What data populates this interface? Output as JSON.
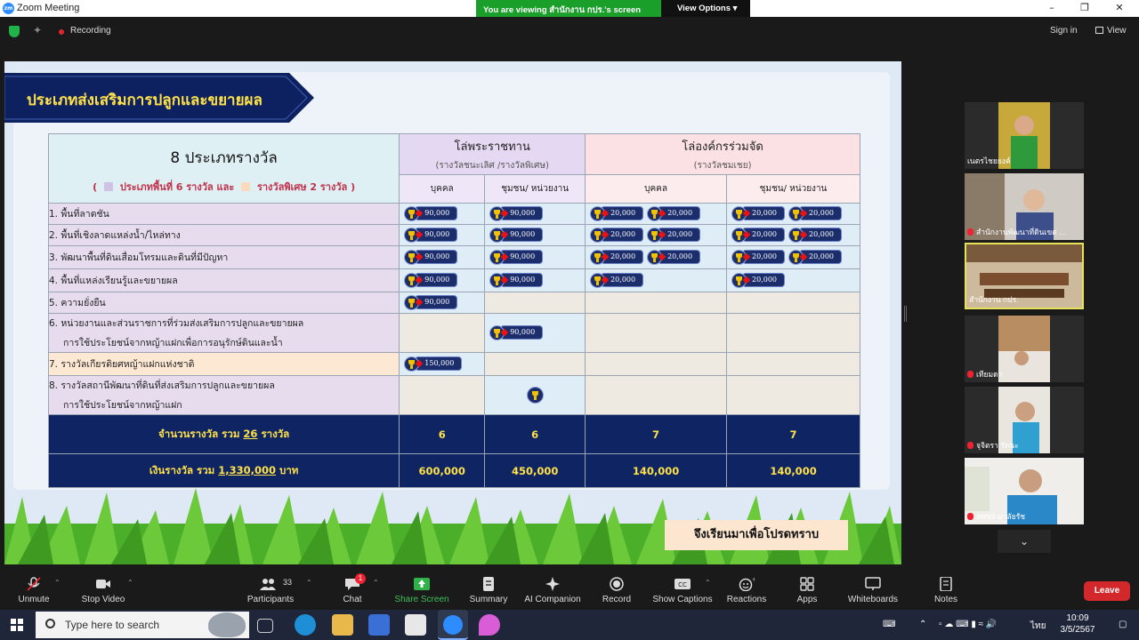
{
  "window": {
    "title": "Zoom Meeting",
    "viewing_message": "You are viewing สำนักงาน กปร.'s screen",
    "view_options": "View Options",
    "recording": "Recording",
    "sign_in": "Sign in",
    "view": "View"
  },
  "slide": {
    "banner_title": "ประเภทส่งเสริมการปลูกและขยายผล",
    "header": {
      "main_title": "8 ประเภทรางวัล",
      "legend_open": "(",
      "legend_area": "ประเภทพื้นที่ 6 รางวัล",
      "legend_and": "และ",
      "legend_special": "รางวัลพิเศษ 2 รางวัล )",
      "group1_title": "โล่พระราชทาน",
      "group1_sub": "(รางวัลชนะเลิศ /รางวัลพิเศษ)",
      "group2_title": "โล่องค์กรร่วมจัด",
      "group2_sub": "(รางวัลชมเชย)",
      "col_individual": "บุคคล",
      "col_community": "ชุมชน/ หน่วยงาน"
    },
    "rows": [
      {
        "label": "1. พื้นที่ลาดชัน",
        "c1": [
          "90,000"
        ],
        "c2": [
          "90,000"
        ],
        "c3": [
          "20,000",
          "20,000"
        ],
        "c4": [
          "20,000",
          "20,000"
        ]
      },
      {
        "label": "2. พื้นที่เชิงลาดแหล่งน้ำ/ไหล่ทาง",
        "c1": [
          "90,000"
        ],
        "c2": [
          "90,000"
        ],
        "c3": [
          "20,000",
          "20,000"
        ],
        "c4": [
          "20,000",
          "20,000"
        ]
      },
      {
        "label": "3. พัฒนาพื้นที่ดินเสื่อมโทรมและดินที่มีปัญหา",
        "c1": [
          "90,000"
        ],
        "c2": [
          "90,000"
        ],
        "c3": [
          "20,000",
          "20,000"
        ],
        "c4": [
          "20,000",
          "20,000"
        ]
      },
      {
        "label": "4. พื้นที่แหล่งเรียนรู้และขยายผล",
        "c1": [
          "90,000"
        ],
        "c2": [
          "90,000"
        ],
        "c3": [
          "20,000"
        ],
        "c4": [
          "20,000"
        ]
      },
      {
        "label": "5. ความยั่งยืน",
        "c1": [
          "90,000"
        ],
        "c2": [],
        "c3": [],
        "c4": []
      },
      {
        "label": "6. หน่วยงานและส่วนราชการที่ร่วมส่งเสริมการปลูกและขยายผล",
        "label2": "การใช้ประโยชน์จากหญ้าแฝกเพื่อการอนุรักษ์ดินและน้ำ",
        "c1": [],
        "c2": [
          "90,000"
        ],
        "c3": [],
        "c4": []
      },
      {
        "label": "7. รางวัลเกียรติยศหญ้าแฝกแห่งชาติ",
        "c1": [
          "150,000"
        ],
        "c2": [],
        "c3": [],
        "c4": []
      },
      {
        "label": "8. รางวัลสถานีพัฒนาที่ดินที่ส่งเสริมการปลูกและขยายผล",
        "label2": "การใช้ประโยชน์จากหญ้าแฝก",
        "c1": [],
        "c2": [
          "cup-only"
        ],
        "c3": [],
        "c4": []
      }
    ],
    "totals": {
      "count_prefix": "จำนวนรางวัล รวม",
      "count_value": "26",
      "count_suffix": "รางวัล",
      "counts": [
        "6",
        "6",
        "7",
        "7"
      ],
      "money_prefix": "เงินรางวัล รวม",
      "money_value": "1,330,000",
      "money_suffix": "บาท",
      "money": [
        "600,000",
        "450,000",
        "140,000",
        "140,000"
      ]
    },
    "ack": "จึงเรียนมาเพื่อโปรดทราบ"
  },
  "participants_panel": [
    {
      "name": "เนตรไชยยงค์",
      "muted": false
    },
    {
      "name": "สำนักงานพัฒนาที่ดินเขต ...",
      "muted": true
    },
    {
      "name": "สำนักงาน กปร.",
      "muted": false,
      "active": true
    },
    {
      "name": "เทียมดา",
      "muted": true
    },
    {
      "name": "จุจิตรา รัตนะ",
      "muted": true
    },
    {
      "name": "สพข9-มาลัยรัช",
      "muted": true
    }
  ],
  "toolbar": {
    "unmute": "Unmute",
    "stop_video": "Stop Video",
    "participants": "Participants",
    "participants_count": "33",
    "chat": "Chat",
    "chat_badge": "1",
    "share_screen": "Share Screen",
    "summary": "Summary",
    "ai_companion": "AI Companion",
    "record": "Record",
    "show_captions": "Show Captions",
    "reactions": "Reactions",
    "apps": "Apps",
    "whiteboards": "Whiteboards",
    "notes": "Notes",
    "leave": "Leave"
  },
  "taskbar": {
    "search_placeholder": "Type here to search",
    "lang": "ไทย",
    "time": "10:09",
    "date": "3/5/2567"
  },
  "colors": {
    "zoom_blue": "#2d8cff",
    "banner_green": "#1a9f2b",
    "slide_navy": "#0f2563",
    "title_yellow": "#ffe14a",
    "leave_red": "#d2282c"
  }
}
